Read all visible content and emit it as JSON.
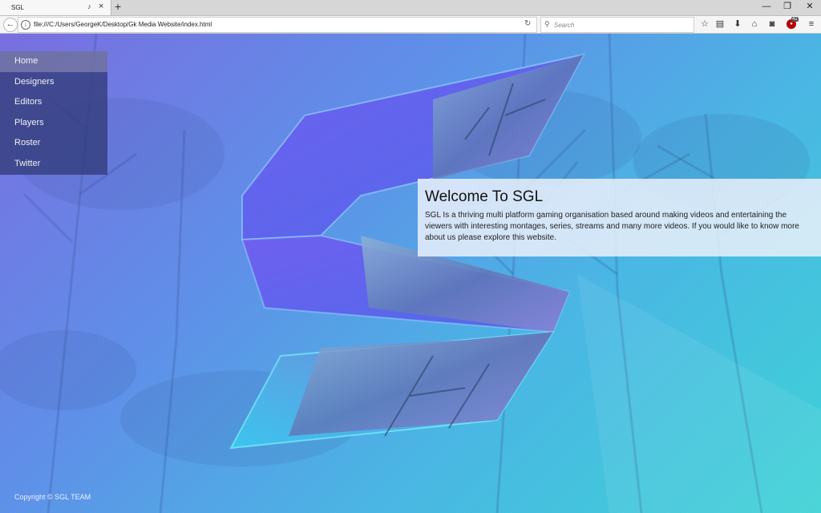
{
  "browser": {
    "tab_title": "SGL",
    "tab_mute_icon": "speaker-mute-icon",
    "new_tab_label": "+",
    "url": "file:///C:/Users/GeorgeK/Desktop/Gk Media Website/index.html",
    "search_placeholder": "Search",
    "window_controls": [
      "minimize",
      "restore",
      "close"
    ],
    "extension_badge_count": "42",
    "toolbar_icons": [
      "bookmark-star-icon",
      "reading-list-icon",
      "download-icon",
      "home-icon",
      "pocket-icon",
      "ublock-icon",
      "menu-icon"
    ]
  },
  "sidebar": {
    "items": [
      {
        "label": "Home"
      },
      {
        "label": "Designers"
      },
      {
        "label": "Editors"
      },
      {
        "label": "Players"
      },
      {
        "label": "Roster"
      },
      {
        "label": "Twitter"
      }
    ]
  },
  "welcome": {
    "title": "Welcome To SGL",
    "body": "SGL Is a thriving multi platform gaming organisation based around making videos and entertaining the viewers with interesting montages, series, streams and many more videos. If you would like to know more about us please explore this website."
  },
  "footer": {
    "copyright": "Copyright © SGL TEAM"
  },
  "colors": {
    "bg_top_left": "#7a6ee0",
    "bg_bottom_right": "#3ed2d6",
    "sidebar_bg": "#323c78",
    "logo_purple": "#6a5ae8",
    "logo_cyan": "#4ee8f0"
  }
}
